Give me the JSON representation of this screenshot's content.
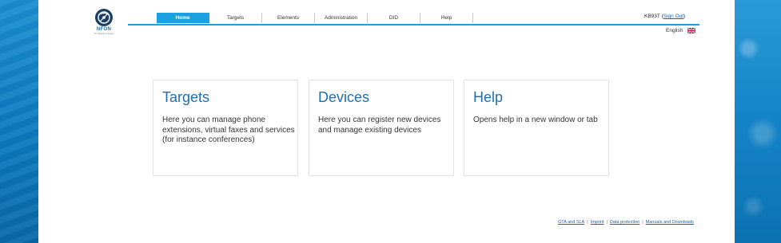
{
  "header": {
    "logo": {
      "wordmark": "NFON",
      "tagline": "The Telephone System"
    },
    "user": {
      "name": "KB93T",
      "sign_out": "Sign Out"
    },
    "language": "English"
  },
  "nav": {
    "items": [
      {
        "label": "Home",
        "active": true
      },
      {
        "label": "Targets"
      },
      {
        "label": "Elements"
      },
      {
        "label": "Administration"
      },
      {
        "label": "DID"
      },
      {
        "label": "Help"
      }
    ]
  },
  "cards": [
    {
      "title": "Targets",
      "description": "Here you can manage phone extensions, virtual faxes and services (for instance conferences)"
    },
    {
      "title": "Devices",
      "description": "Here you can register new devices and manage existing devices"
    },
    {
      "title": "Help",
      "description": "Opens help in a new window or tab"
    }
  ],
  "footer": {
    "links": [
      "GTA and SLA",
      "Imprint",
      "Data protection",
      "Manuals and Downloads"
    ],
    "separator": "|"
  },
  "colors": {
    "accent": "#1ba1e2",
    "title_blue": "#1d6faf",
    "background_blue": "#0f7fc0"
  }
}
